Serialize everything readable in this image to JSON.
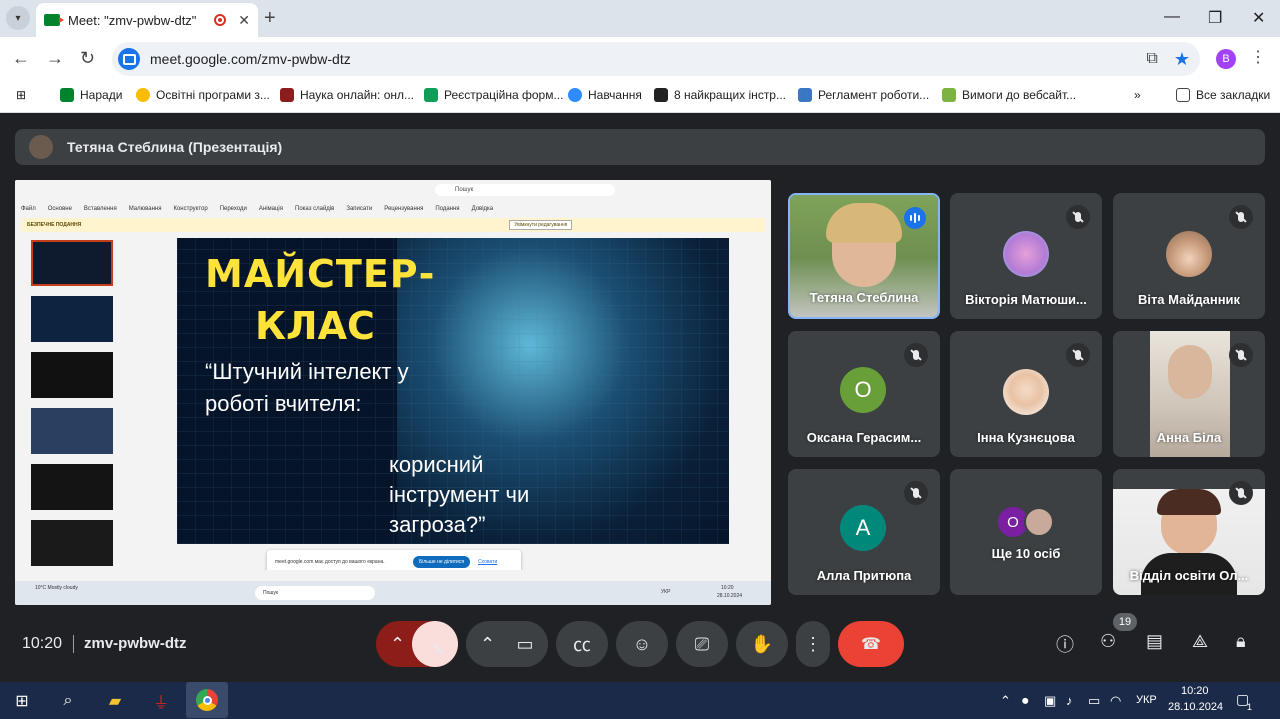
{
  "browser": {
    "tab_title": "Meet: \"zmv-pwbw-dtz\"",
    "url": "meet.google.com/zmv-pwbw-dtz",
    "profile_initial": "B"
  },
  "bookmarks": {
    "items": [
      {
        "label": "Наради",
        "color": "#00832d"
      },
      {
        "label": "Освітні програми з...",
        "color": "#fbbc04"
      },
      {
        "label": "Наука онлайн: онл...",
        "color": "#8b1d1d"
      },
      {
        "label": "Реєстраційна форм...",
        "color": "#0f9d58"
      },
      {
        "label": "Навчання",
        "color": "#2d8cff"
      },
      {
        "label": "8 найкращих інстр...",
        "color": "#222222"
      },
      {
        "label": "Регламент роботи...",
        "color": "#3b78c3"
      },
      {
        "label": "Вимоги до вебсайт...",
        "color": "#7cb342"
      }
    ],
    "all_bookmarks": "Все закладки"
  },
  "meet": {
    "presenter_label": "Тетяна Стеблина (Презентація)",
    "clock": "10:20",
    "meeting_code": "zmv-pwbw-dtz",
    "participant_count": "19"
  },
  "slide": {
    "title_line1": "МАЙСТЕР-",
    "title_line2": "КЛАС",
    "quote_part1": "“Штучний інтелект у роботі вчителя:",
    "quote_part2": "корисний інструмент чи загроза?”",
    "app_search": "Пошук",
    "warning_label": "БЕЗПЕЧНЕ ПОДАННЯ",
    "enable_editing": "Увімкнути редагування",
    "notify_btn": "Більше не ділитися",
    "notify_hide": "Сховати",
    "menu": [
      "Файл",
      "Основне",
      "Вставлення",
      "Малювання",
      "Конструктор",
      "Переходи",
      "Анімація",
      "Показ слайдів",
      "Записати",
      "Рецензування",
      "Подання",
      "Довідка"
    ],
    "taskbar_search": "Пошук",
    "weather": "10°C Mostly cloudy",
    "tray_lang": "УКР",
    "tray_time": "10:20",
    "tray_date": "28.10.2024"
  },
  "participants": [
    {
      "name": "Тетяна Стеблина",
      "type": "video"
    },
    {
      "name": "Вікторія Матюши...",
      "type": "photo"
    },
    {
      "name": "Віта Майданник",
      "type": "photo"
    },
    {
      "name": "Оксана Герасим...",
      "type": "letter",
      "letter": "О",
      "color": "#689f38"
    },
    {
      "name": "Інна Кузнєцова",
      "type": "photo"
    },
    {
      "name": "Анна Біла",
      "type": "video"
    },
    {
      "name": "Алла Притюпа",
      "type": "letter",
      "letter": "А",
      "color": "#00897b"
    },
    {
      "name": "Ще 10 осіб",
      "type": "more",
      "letter": "О"
    },
    {
      "name": "Відділ освіти Ол...",
      "type": "video"
    }
  ],
  "taskbar": {
    "lang": "УКР",
    "time": "10:20",
    "date": "28.10.2024",
    "notifications": "1"
  }
}
